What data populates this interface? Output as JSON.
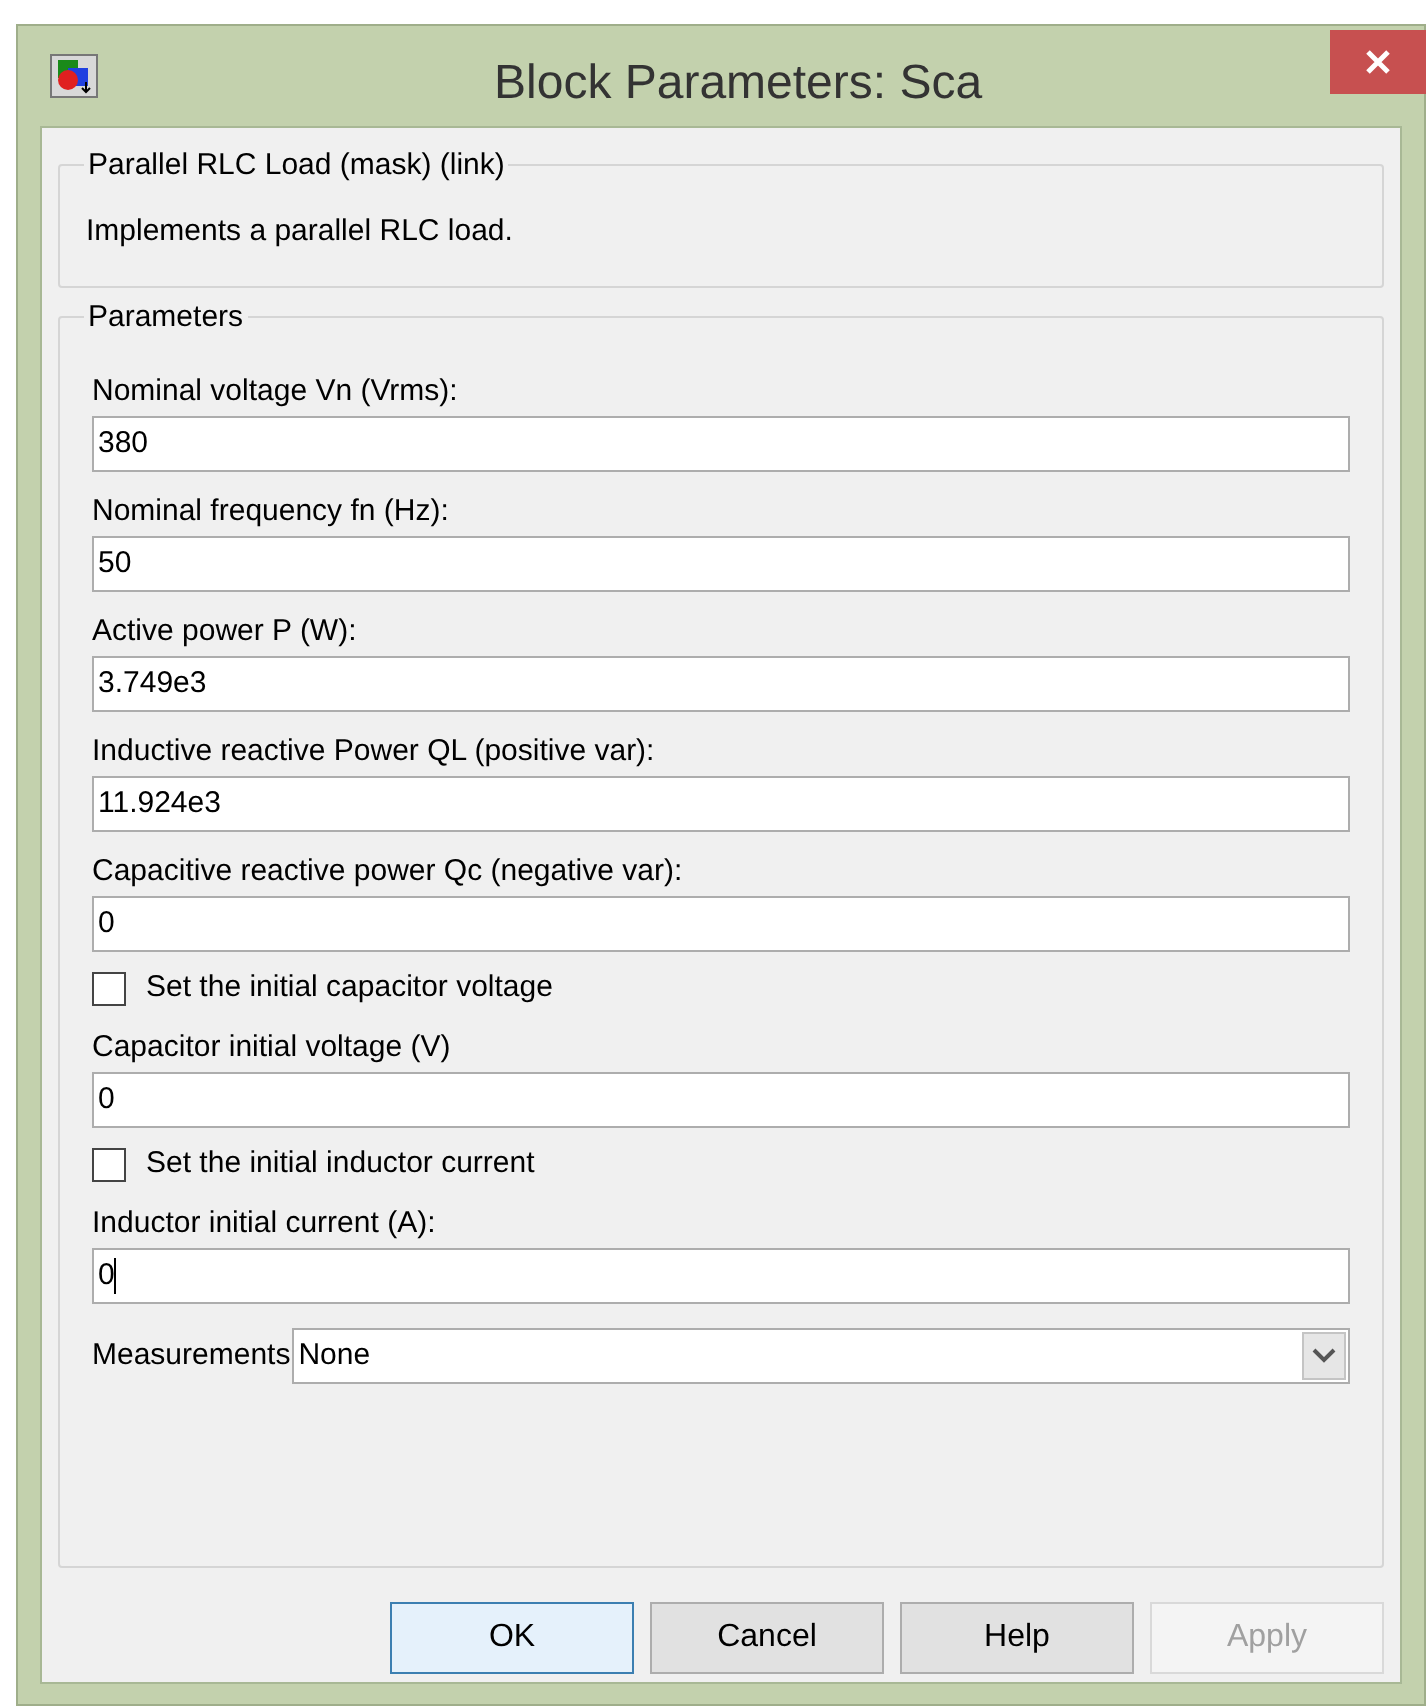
{
  "window": {
    "title": "Block Parameters: Sca"
  },
  "description": {
    "title": "Parallel RLC Load (mask) (link)",
    "text": "Implements a parallel RLC load."
  },
  "parameters": {
    "title": "Parameters",
    "items": [
      {
        "kind": "text",
        "label": "Nominal voltage Vn (Vrms):",
        "value": "380"
      },
      {
        "kind": "text",
        "label": "Nominal frequency fn (Hz):",
        "value": "50"
      },
      {
        "kind": "text",
        "label": "Active power P (W):",
        "value": "3.749e3"
      },
      {
        "kind": "text",
        "label": "Inductive reactive Power QL (positive var):",
        "value": "11.924e3"
      },
      {
        "kind": "text",
        "label": "Capacitive reactive power Qc (negative var):",
        "value": "0"
      },
      {
        "kind": "checkbox",
        "label": "Set the initial capacitor voltage",
        "checked": false
      },
      {
        "kind": "text",
        "label": "Capacitor initial voltage (V)",
        "value": "0"
      },
      {
        "kind": "checkbox",
        "label": "Set the initial inductor current",
        "checked": false
      },
      {
        "kind": "text",
        "label": "Inductor initial current (A):",
        "value": "0",
        "focused": true
      },
      {
        "kind": "select",
        "label": "Measurements",
        "value": "None"
      }
    ]
  },
  "buttons": [
    {
      "label": "OK",
      "default": true,
      "disabled": false
    },
    {
      "label": "Cancel",
      "default": false,
      "disabled": false
    },
    {
      "label": "Help",
      "default": false,
      "disabled": false
    },
    {
      "label": "Apply",
      "default": false,
      "disabled": true
    }
  ]
}
